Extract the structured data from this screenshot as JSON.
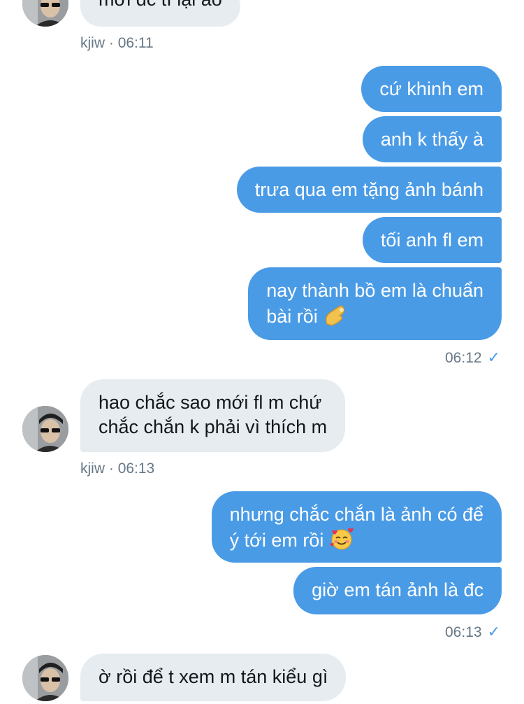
{
  "conversation": {
    "partner_name": "kjiw",
    "messages": [
      {
        "id": "m1",
        "side": "in",
        "text": "mới đc tí lại ảo"
      },
      {
        "id": "m2",
        "side": "out",
        "text": "cứ khinh em"
      },
      {
        "id": "m3",
        "side": "out",
        "text": "anh k thấy à"
      },
      {
        "id": "m4",
        "side": "out",
        "text": "trưa qua em tặng ảnh bánh"
      },
      {
        "id": "m5",
        "side": "out",
        "text": "tối anh fl em"
      },
      {
        "id": "m6",
        "side": "out",
        "line1": "nay thành bồ em là chuẩn",
        "line2": "bài rồi",
        "emoji": "pinching-hand-emoji"
      },
      {
        "id": "m7",
        "side": "in",
        "line1": "hao chắc sao mới fl m chứ",
        "line2": "chắc chắn k phải vì thích m"
      },
      {
        "id": "m8",
        "side": "out",
        "line1": "nhưng chắc chắn là ảnh có để",
        "line2": "ý tới em rồi",
        "emoji": "smiling-face-with-hearts-emoji"
      },
      {
        "id": "m9",
        "side": "out",
        "text": "giờ em tán ảnh là đc"
      },
      {
        "id": "m10",
        "side": "in",
        "text": "ờ rồi để t xem m tán kiểu gì"
      }
    ],
    "timestamps": {
      "t1": {
        "sender": "kjiw",
        "sep": "·",
        "time": "06:11"
      },
      "t2": {
        "time": "06:12",
        "status": "✓"
      },
      "t3": {
        "sender": "kjiw",
        "sep": "·",
        "time": "06:13"
      },
      "t4": {
        "time": "06:13",
        "status": "✓"
      }
    }
  },
  "colors": {
    "incoming_bubble": "#e6ecf0",
    "outgoing_bubble": "#4a9be6",
    "meta_text": "#657786",
    "read_check": "#4a9be6"
  }
}
